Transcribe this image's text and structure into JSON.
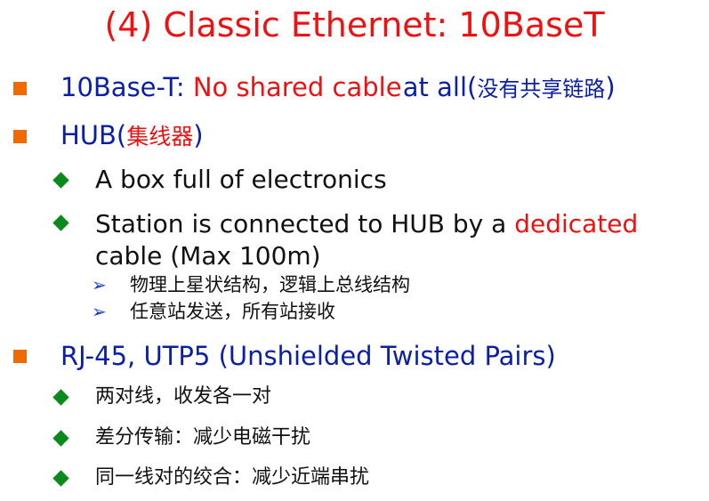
{
  "slide": {
    "title": "(4) Classic Ethernet: 10BaseT",
    "bullets": [
      {
        "prefix": "10Base-T:",
        "highlight": "No shared cable",
        "suffix": "at all(",
        "cjk": "没有共享链路",
        "close": ")"
      },
      {
        "prefix": "HUB(",
        "cjk": "集线器",
        "close": ")"
      },
      {
        "text": "RJ-45, UTP5  (Unshielded Twisted Pairs)"
      }
    ],
    "hub_sub": [
      {
        "text": "A box full of electronics"
      },
      {
        "line1": "Station is connected to HUB by a",
        "highlight": "dedicated",
        "line2": "cable (Max 100m)"
      }
    ],
    "hub_sub_sub": [
      "物理上星状结构，逻辑上总线结构",
      "任意站发送，所有站接收"
    ],
    "rj45_sub": [
      "两对线，收发各一对",
      "差分传输：减少电磁干扰",
      "同一线对的绞合：减少近端串扰"
    ]
  },
  "colors": {
    "title": "#ee1111",
    "bullet_square": "#ef6a00",
    "bullet_diamond": "#0b8a1c",
    "arrow": "#1a3bcc",
    "level1_text": "#0a1fa8",
    "highlight": "#ee1111"
  },
  "icons": {
    "level1": "orange-square-bullet-icon",
    "level2": "green-diamond-bullet-icon",
    "level3": "blue-arrow-bullet-icon"
  }
}
